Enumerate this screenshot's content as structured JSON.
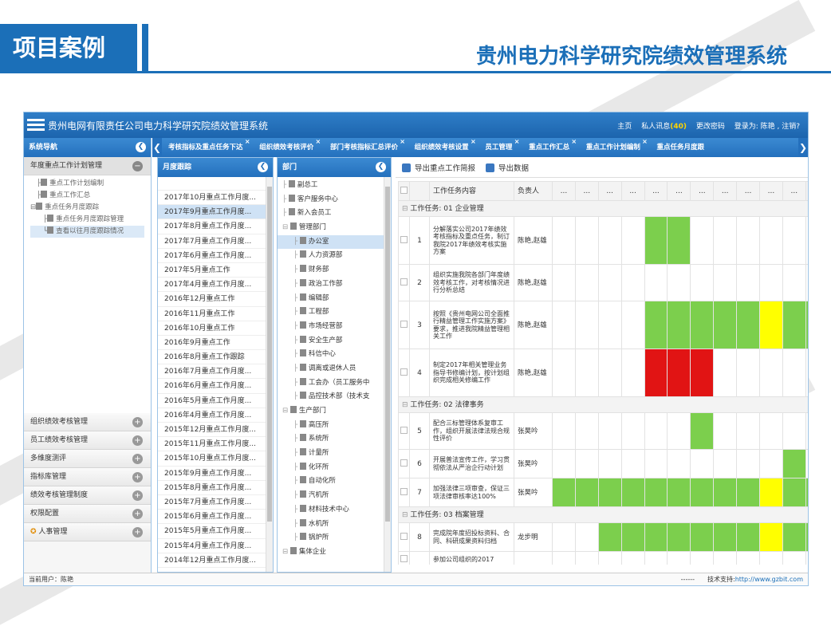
{
  "slide": {
    "title": "项目案例",
    "system_title": "贵州电力科学研究院绩效管理系统"
  },
  "app": {
    "title": "贵州电网有限责任公司电力科学研究院绩效管理系统",
    "nav": {
      "home": "主页",
      "messages_label": "私人讯息",
      "messages_count": "(40)",
      "change_password": "更改密码",
      "login": "登录为: 陈艳 , 注销?"
    }
  },
  "sidebar": {
    "header": "系统导航",
    "active": "年度重点工作计划管理",
    "tree": [
      "重点工作计划编制",
      "重点工作汇总",
      "重点任务月度跟踪",
      "重点任务月度跟踪管理",
      "查看以往月度跟踪情况"
    ],
    "items": [
      "组织绩效考核管理",
      "员工绩效考核管理",
      "多维度测评",
      "指标库管理",
      "绩效考核管理制度",
      "权限配置",
      "人事管理"
    ]
  },
  "tabs": [
    "考核指标及重点任务下达",
    "组织绩效考核评价",
    "部门考核指标汇总评价",
    "组织绩效考核设置",
    "员工管理",
    "重点工作汇总",
    "重点工作计划编制",
    "重点任务月度跟"
  ],
  "month_panel": {
    "header": "月度跟踪",
    "items": [
      "2017年10月重点工作月度...",
      "2017年9月重点工作月度...",
      "2017年8月重点工作月度...",
      "2017年7月重点工作月度...",
      "2017年6月重点工作月度...",
      "2017年5月重点工作",
      "2017年4月重点工作月度...",
      "2016年12月重点工作",
      "2016年11月重点工作",
      "2016年10月重点工作",
      "2016年9月重点工作",
      "2016年8月重点工作跟踪",
      "2016年7月重点工作月度...",
      "2016年6月重点工作月度...",
      "2016年5月重点工作月度...",
      "2016年4月重点工作月度...",
      "2015年12月重点工作月度...",
      "2015年11月重点工作月度...",
      "2015年10月重点工作月度...",
      "2015年9月重点工作月度...",
      "2015年8月重点工作月度...",
      "2015年7月重点工作月度...",
      "2015年6月重点工作月度...",
      "2015年5月重点工作月度...",
      "2015年4月重点工作月度...",
      "2014年12月重点工作月度..."
    ]
  },
  "dept_panel": {
    "header": "部门",
    "items": [
      "副总工",
      "客户服务中心",
      "新入会员工",
      "管理部门",
      "办公室",
      "人力资源部",
      "财务部",
      "政治工作部",
      "编辑部",
      "工程部",
      "市场经营部",
      "安全生产部",
      "科信中心",
      "调离或退休人员",
      "工会办（员工服务中",
      "品控技术部（技术支",
      "生产部门",
      "高压所",
      "系统所",
      "计量所",
      "化环所",
      "自动化所",
      "汽机所",
      "材料技术中心",
      "水机所",
      "锅炉所",
      "集体企业"
    ]
  },
  "toolbar": {
    "export_brief": "导出重点工作简报",
    "export_data": "导出数据"
  },
  "grid": {
    "columns": {
      "task": "工作任务内容",
      "person": "负责人",
      "more": "..."
    },
    "groups": [
      {
        "title": "工作任务: 01 企业管理",
        "rows": [
          {
            "no": "1",
            "task": "分解落实公司2017年绩效考核指标及重点任务，制订我院2017年绩效考核实施方案",
            "person": "陈艳,赵雄",
            "cells": "____gg______"
          },
          {
            "no": "2",
            "task": "组织实施我院各部门年度绩效考核工作，对考核情况进行分析总结",
            "person": "陈艳,赵雄",
            "cells": "____________"
          },
          {
            "no": "3",
            "task": "按照《贵州电网公司全面推行精益管理工作实施方案》要求，推进我院精益管理相关工作",
            "person": "陈艳,赵雄",
            "cells": "____gggggygg"
          },
          {
            "no": "4",
            "task": "制定2017年相关管理业务指导书修编计划，按计划组织完成相关修编工作",
            "person": "陈艳,赵雄",
            "cells": "____rrr_____"
          }
        ]
      },
      {
        "title": "工作任务: 02 法律事务",
        "rows": [
          {
            "no": "5",
            "task": "配合三标管理体系复审工作，组织开展法律法规合规性评价",
            "person": "张昊吟",
            "cells": "______g_____"
          },
          {
            "no": "6",
            "task": "开展普法宣传工作，学习贯彻依法从严治企行动计划",
            "person": "张昊吟",
            "cells": "__________g_"
          },
          {
            "no": "7",
            "task": "加强法律三项审查，保证三项法律审核率达100%",
            "person": "张昊吟",
            "cells": "gggggggggygg"
          }
        ]
      },
      {
        "title": "工作任务: 03 档案管理",
        "rows": [
          {
            "no": "8",
            "task": "完成院年度招投标资料、合同、科研成果资料归档",
            "person": "龙步明",
            "cells": "__gggggggygg"
          },
          {
            "no": "",
            "task": "参加公司组织的2017",
            "person": "",
            "cells": "____________"
          }
        ]
      }
    ]
  },
  "status": {
    "user_label": "当前用户：",
    "user": "陈艳",
    "dashes": "------",
    "support": "技术支持:",
    "url": "http://www.gzbit.com"
  }
}
